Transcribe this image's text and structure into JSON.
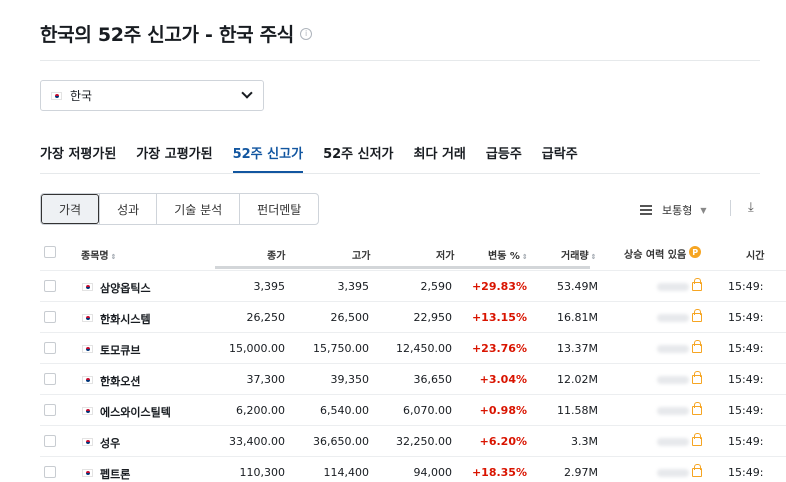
{
  "page": {
    "title": "한국의 52주 신고가 - 한국 주식"
  },
  "country_select": {
    "value": "한국"
  },
  "tabs": [
    {
      "label": "가장 저평가된"
    },
    {
      "label": "가장 고평가된"
    },
    {
      "label": "52주 신고가",
      "active": true
    },
    {
      "label": "52주 신저가"
    },
    {
      "label": "최다 거래"
    },
    {
      "label": "급등주"
    },
    {
      "label": "급락주"
    }
  ],
  "segments": [
    "가격",
    "성과",
    "기술 분석",
    "펀더멘탈"
  ],
  "view_select": {
    "label": "보통형"
  },
  "table": {
    "headers": {
      "name": "종목명",
      "price": "종가",
      "high": "고가",
      "low": "저가",
      "change": "변동 %",
      "volume": "거래량",
      "upside": "상승 여력 있음",
      "time": "시간"
    },
    "rows": [
      {
        "name": "삼양옵틱스",
        "price": "3,395",
        "high": "3,395",
        "low": "2,590",
        "change": "+29.83%",
        "volume": "53.49M",
        "time": "15:49:"
      },
      {
        "name": "한화시스템",
        "price": "26,250",
        "high": "26,500",
        "low": "22,950",
        "change": "+13.15%",
        "volume": "16.81M",
        "time": "15:49:"
      },
      {
        "name": "토모큐브",
        "price": "15,000.00",
        "high": "15,750.00",
        "low": "12,450.00",
        "change": "+23.76%",
        "volume": "13.37M",
        "time": "15:49:"
      },
      {
        "name": "한화오션",
        "price": "37,300",
        "high": "39,350",
        "low": "36,650",
        "change": "+3.04%",
        "volume": "12.02M",
        "time": "15:49:"
      },
      {
        "name": "에스와이스틸텍",
        "price": "6,200.00",
        "high": "6,540.00",
        "low": "6,070.00",
        "change": "+0.98%",
        "volume": "11.58M",
        "time": "15:49:"
      },
      {
        "name": "성우",
        "price": "33,400.00",
        "high": "36,650.00",
        "low": "32,250.00",
        "change": "+6.20%",
        "volume": "3.3M",
        "time": "15:49:"
      },
      {
        "name": "펩트론",
        "price": "110,300",
        "high": "114,400",
        "low": "94,000",
        "change": "+18.35%",
        "volume": "2.97M",
        "time": "15:49:"
      }
    ]
  },
  "colors": {
    "accent": "#1256a0",
    "positive": "#d91400",
    "pro_badge": "#f6a522"
  }
}
